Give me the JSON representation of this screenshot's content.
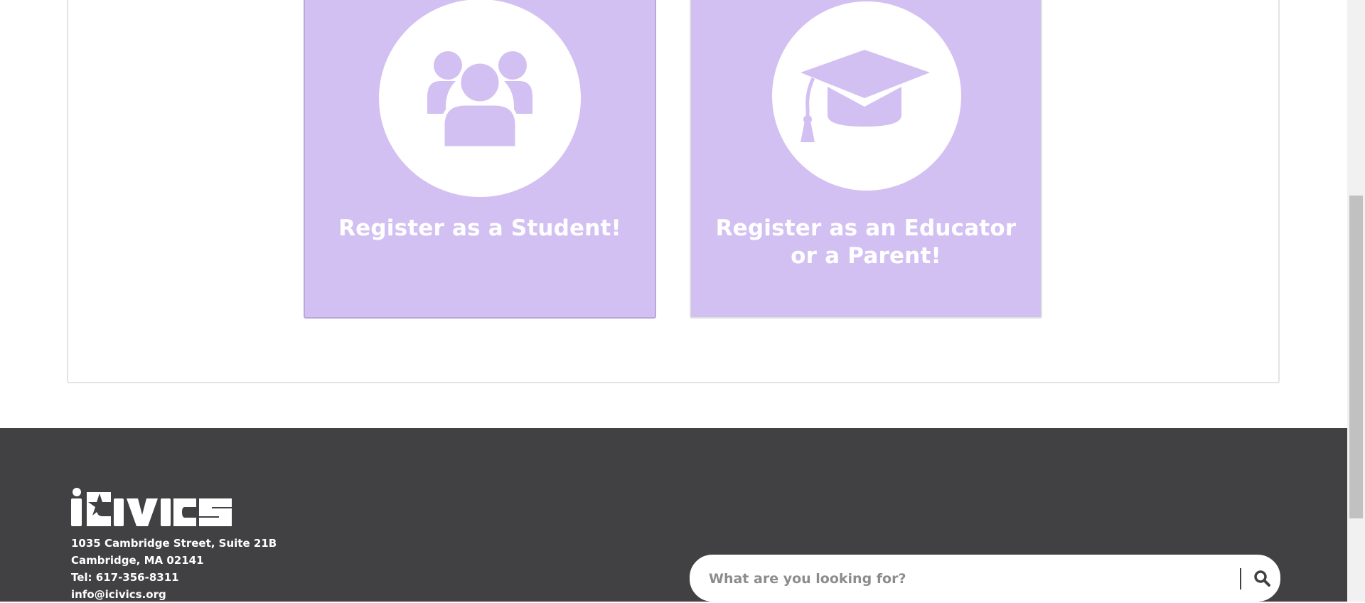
{
  "register": {
    "student": {
      "label": "Register as a Student!",
      "icon": "users-icon"
    },
    "educator": {
      "label": "Register as an Educator or a Parent!",
      "icon": "graduation-cap-icon"
    }
  },
  "footer": {
    "logo_text": "iCivics",
    "address": {
      "street": "1035 Cambridge Street, Suite 21B",
      "city": "Cambridge, MA 02141",
      "tel": "Tel: 617-356-8311",
      "email": "info@icivics.org"
    },
    "search": {
      "placeholder": "What are you looking for?",
      "icon": "search-icon"
    }
  },
  "colors": {
    "card_purple": "#d3c0f2",
    "footer_bg": "#414042",
    "white": "#ffffff"
  }
}
